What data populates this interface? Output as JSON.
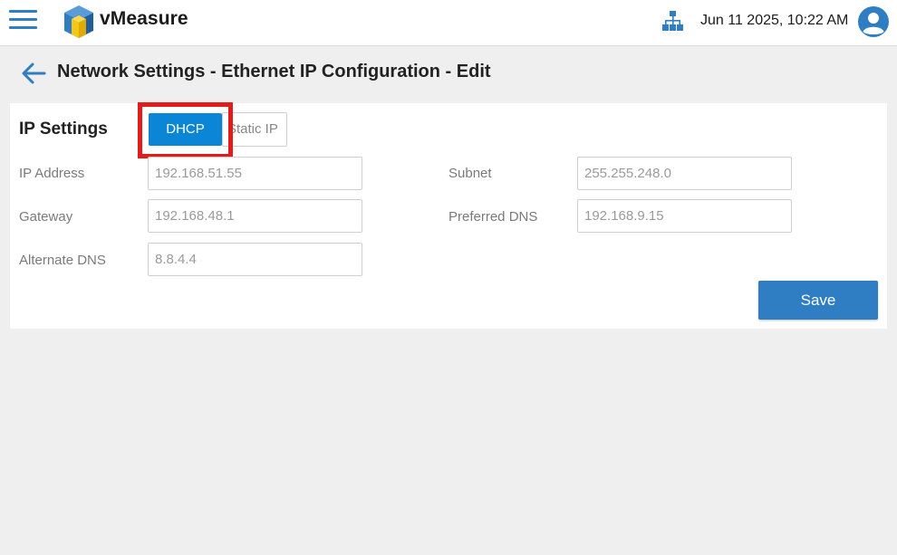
{
  "header": {
    "app_name": "vMeasure",
    "datetime": "Jun 11 2025, 10:22 AM",
    "icons": {
      "menu": "hamburger-menu-icon",
      "logo": "cube-logo-icon",
      "network": "network-hierarchy-icon",
      "user": "user-account-icon"
    }
  },
  "page": {
    "title": "Network Settings - Ethernet IP Configuration - Edit",
    "back_icon": "back-arrow-icon"
  },
  "ip_settings": {
    "section_title": "IP Settings",
    "modes": {
      "dhcp": "DHCP",
      "static": "Static IP",
      "selected": "DHCP"
    },
    "fields": {
      "ip_address": {
        "label": "IP Address",
        "value": "192.168.51.55"
      },
      "subnet": {
        "label": "Subnet",
        "value": "255.255.248.0"
      },
      "gateway": {
        "label": "Gateway",
        "value": "192.168.48.1"
      },
      "preferred_dns": {
        "label": "Preferred DNS",
        "value": "192.168.9.15"
      },
      "alternate_dns": {
        "label": "Alternate DNS",
        "value": "8.8.4.4"
      }
    },
    "save_label": "Save"
  },
  "colors": {
    "accent": "#2f7dc2",
    "dhcp_active": "#0b86d6",
    "highlight": "#e21b1b",
    "background": "#efefef"
  }
}
